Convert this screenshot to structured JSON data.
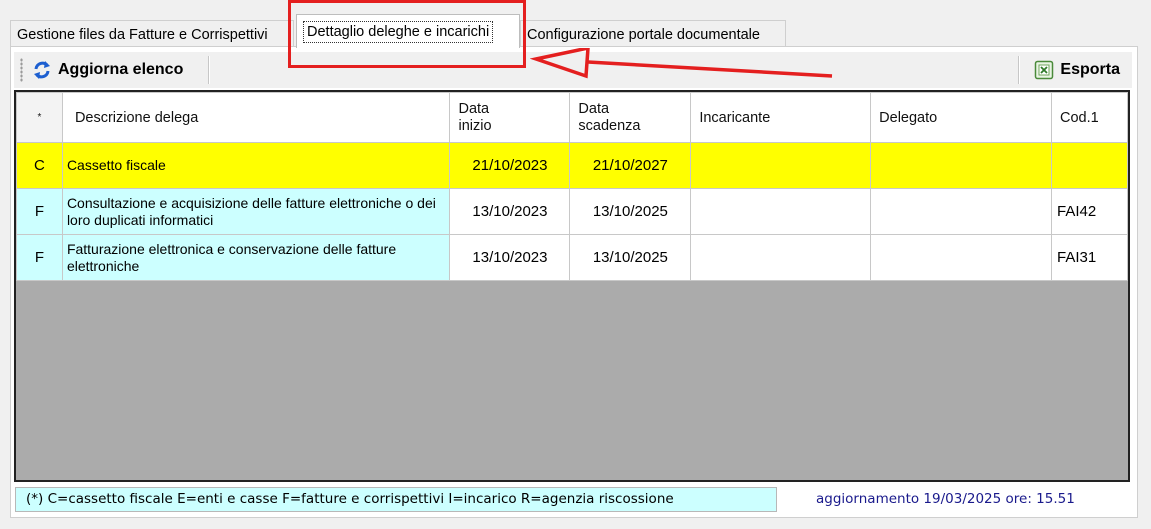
{
  "tabs": [
    {
      "label": "Gestione files da Fatture e Corrispettivi"
    },
    {
      "label": "Dettaglio deleghe e incarichi"
    },
    {
      "label": "Configurazione portale documentale"
    }
  ],
  "toolbar": {
    "refresh_label": "Aggiorna elenco",
    "refresh_icon": "refresh-icon",
    "export_label": "Esporta",
    "export_icon": "excel-icon"
  },
  "grid": {
    "columns": [
      "*",
      "Descrizione delega",
      "Data\ninizio",
      "Data\nscadenza",
      "Incaricante",
      "Delegato",
      "Cod.1"
    ],
    "rows": [
      {
        "flag": "C",
        "descrizione": "Cassetto fiscale",
        "data_inizio": "21/10/2023",
        "data_scadenza": "21/10/2027",
        "incaricante": "",
        "delegato": "",
        "cod1": "",
        "highlight": "#ffff00"
      },
      {
        "flag": "F",
        "descrizione": "Consultazione e acquisizione delle fatture elettroniche o dei loro duplicati informatici",
        "data_inizio": "13/10/2023",
        "data_scadenza": "13/10/2025",
        "incaricante": "",
        "delegato": "",
        "cod1": "FAI42",
        "highlight": "#ccffff"
      },
      {
        "flag": "F",
        "descrizione": "Fatturazione elettronica e conservazione delle fatture elettroniche",
        "data_inizio": "13/10/2023",
        "data_scadenza": "13/10/2025",
        "incaricante": "",
        "delegato": "",
        "cod1": "FAI31",
        "highlight": "#ccffff"
      }
    ]
  },
  "status": {
    "legend": "(*) C=cassetto fiscale  E=enti e casse  F=fatture e corrispettivi  I=incarico  R=agenzia riscossione",
    "last_update": "aggiornamento 19/03/2025 ore: 15.51"
  },
  "colors": {
    "annotation": "#e41f1f",
    "row_yellow": "#ffff00",
    "row_cyan": "#ccffff",
    "grid_empty": "#ababab"
  }
}
